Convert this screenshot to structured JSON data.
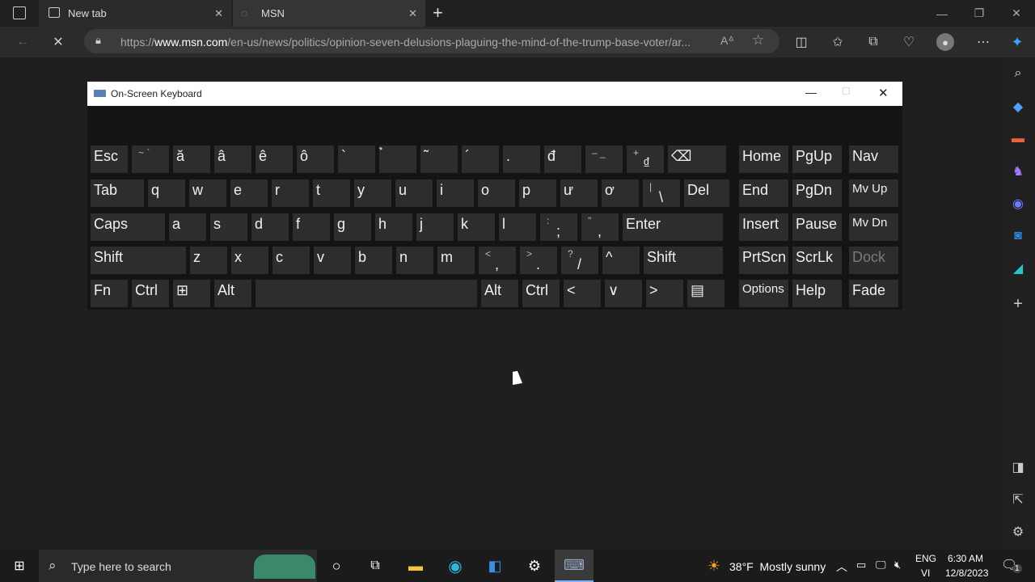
{
  "browser": {
    "tabs": [
      {
        "label": "New tab"
      },
      {
        "label": "MSN"
      }
    ],
    "url": {
      "prefix": "https://",
      "domain": "www.msn.com",
      "path": "/en-us/news/politics/opinion-seven-delusions-plaguing-the-mind-of-the-trump-base-voter/ar..."
    }
  },
  "osk": {
    "title": "On-Screen Keyboard",
    "rows": [
      [
        {
          "label": "Esc"
        },
        {
          "label": "",
          "sub": "~ `"
        },
        {
          "label": "ă"
        },
        {
          "label": "â"
        },
        {
          "label": "ê"
        },
        {
          "label": "ô"
        },
        {
          "label": "`"
        },
        {
          "label": "̉"
        },
        {
          "label": "̃"
        },
        {
          "label": "´"
        },
        {
          "label": "."
        },
        {
          "label": "đ"
        },
        {
          "label": "",
          "sub": "– _"
        },
        {
          "label": "₫",
          "sub": "+"
        },
        {
          "label": "⌫"
        }
      ],
      [
        {
          "label": "Tab"
        },
        {
          "label": "q"
        },
        {
          "label": "w"
        },
        {
          "label": "e"
        },
        {
          "label": "r"
        },
        {
          "label": "t"
        },
        {
          "label": "y"
        },
        {
          "label": "u"
        },
        {
          "label": "i"
        },
        {
          "label": "o"
        },
        {
          "label": "p"
        },
        {
          "label": "ư"
        },
        {
          "label": "ơ"
        },
        {
          "label": "\\",
          "sub": "|"
        },
        {
          "label": "Del"
        }
      ],
      [
        {
          "label": "Caps"
        },
        {
          "label": "a"
        },
        {
          "label": "s"
        },
        {
          "label": "d"
        },
        {
          "label": "f"
        },
        {
          "label": "g"
        },
        {
          "label": "h"
        },
        {
          "label": "j"
        },
        {
          "label": "k"
        },
        {
          "label": "l"
        },
        {
          "label": ";",
          "sub": ":"
        },
        {
          "label": ",",
          "sub": "\""
        },
        {
          "label": "Enter"
        }
      ],
      [
        {
          "label": "Shift"
        },
        {
          "label": "z"
        },
        {
          "label": "x"
        },
        {
          "label": "c"
        },
        {
          "label": "v"
        },
        {
          "label": "b"
        },
        {
          "label": "n"
        },
        {
          "label": "m"
        },
        {
          "label": ",",
          "sub": "<"
        },
        {
          "label": ".",
          "sub": ">"
        },
        {
          "label": "/",
          "sub": "?"
        },
        {
          "label": "^"
        },
        {
          "label": "Shift"
        }
      ],
      [
        {
          "label": "Fn"
        },
        {
          "label": "Ctrl"
        },
        {
          "label": "⊞"
        },
        {
          "label": "Alt"
        },
        {
          "label": ""
        },
        {
          "label": "Alt"
        },
        {
          "label": "Ctrl"
        },
        {
          "label": "<"
        },
        {
          "label": "∨"
        },
        {
          "label": ">"
        },
        {
          "label": "▤"
        }
      ]
    ],
    "nav": [
      [
        "Home",
        "PgUp",
        "Nav"
      ],
      [
        "End",
        "PgDn",
        "Mv Up"
      ],
      [
        "Insert",
        "Pause",
        "Mv Dn"
      ],
      [
        "PrtScn",
        "ScrLk",
        "Dock"
      ],
      [
        "Options",
        "Help",
        "Fade"
      ]
    ]
  },
  "taskbar": {
    "search_placeholder": "Type here to search",
    "weather": "38°F  Mostly sunny",
    "lang_top": "ENG",
    "lang_bottom": "VI",
    "time": "6:30 AM",
    "date": "12/8/2023",
    "notification_count": "1"
  }
}
